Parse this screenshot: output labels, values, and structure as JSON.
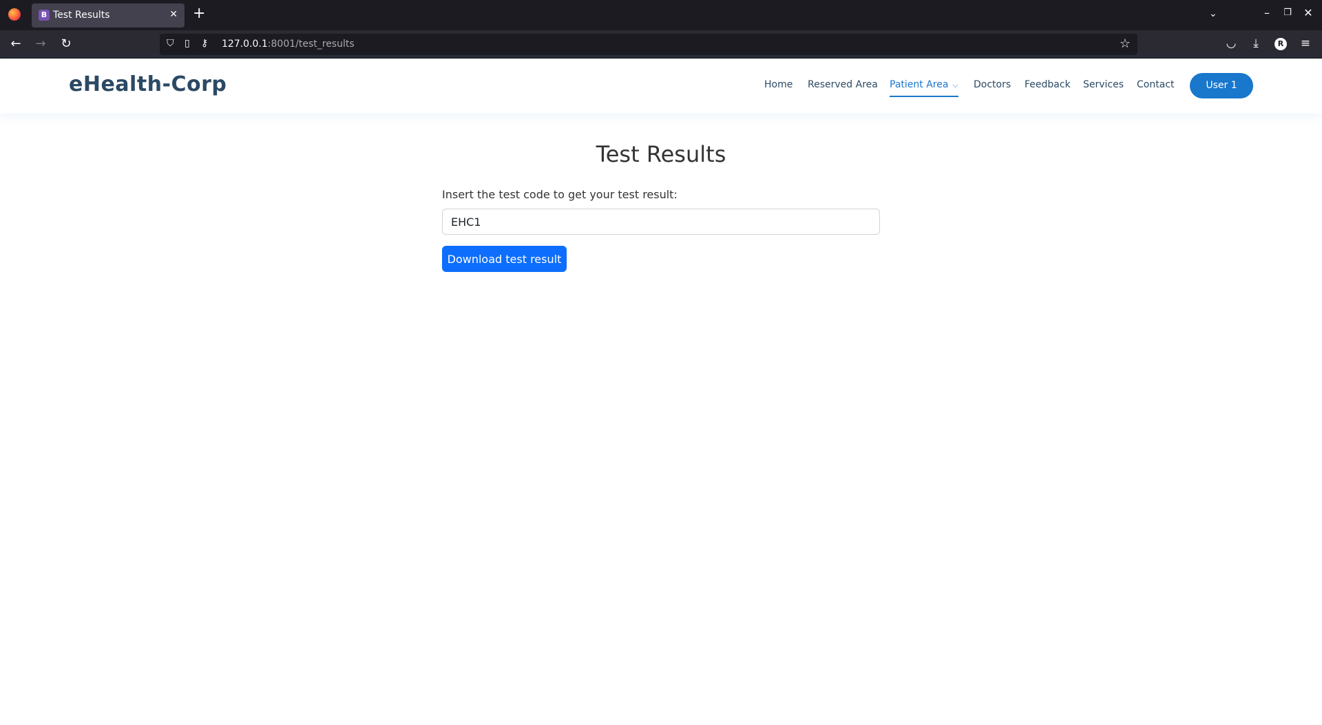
{
  "browser": {
    "tab_title": "Test Results",
    "tab_favicon_letter": "B",
    "url_host": "127.0.0.1",
    "url_rest": ":8001/test_results",
    "profile_initial": "R"
  },
  "site": {
    "logo": "eHealth-Corp",
    "menu": [
      {
        "label": "Home"
      },
      {
        "label": "Reserved Area"
      },
      {
        "label": "Patient Area",
        "active": true,
        "dropdown": true
      },
      {
        "label": "Doctors"
      },
      {
        "label": "Feedback"
      },
      {
        "label": "Services"
      },
      {
        "label": "Contact"
      }
    ],
    "user_button": "User 1",
    "accent_color": "#1977cc",
    "text_color": "#2c4964"
  },
  "main": {
    "title": "Test Results",
    "label": "Insert the test code to get your test result:",
    "input_value": "EHC1",
    "submit_label": "Download test result",
    "button_color": "#0d6efd"
  }
}
